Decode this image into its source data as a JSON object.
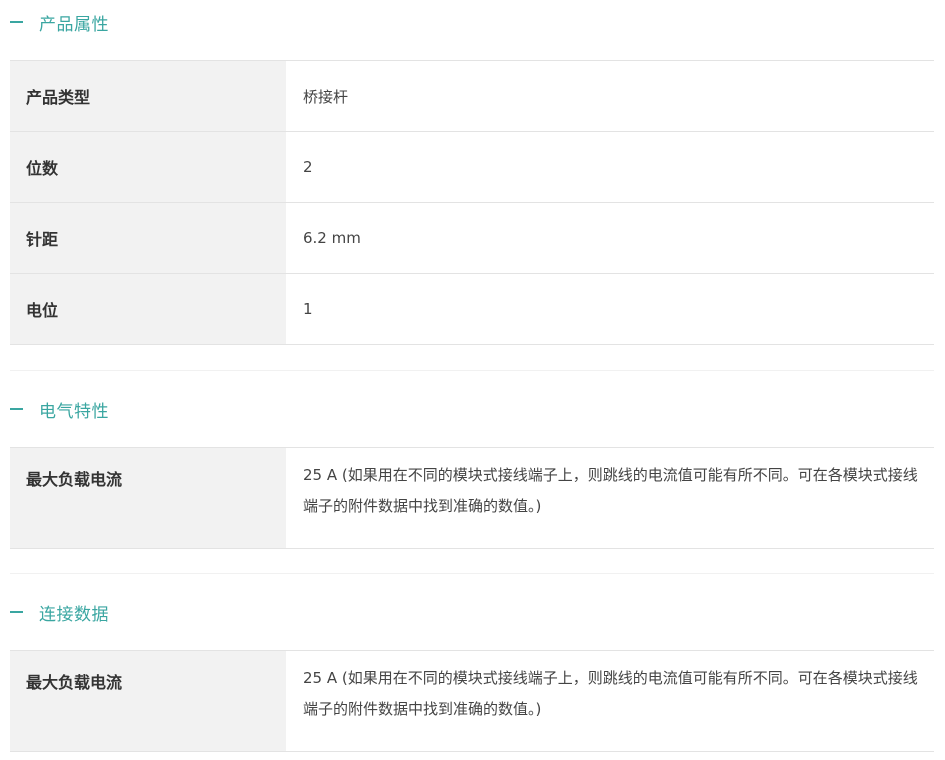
{
  "sections": [
    {
      "title": "产品属性",
      "rows": [
        {
          "label": "产品类型",
          "value": "桥接杆"
        },
        {
          "label": "位数",
          "value": "2"
        },
        {
          "label": "针距",
          "value": "6.2 mm"
        },
        {
          "label": "电位",
          "value": "1"
        }
      ]
    },
    {
      "title": "电气特性",
      "rows": [
        {
          "label": "最大负载电流",
          "value": "25 A (如果用在不同的模块式接线端子上，则跳线的电流值可能有所不同。可在各模块式接线端子的附件数据中找到准确的数值。)"
        }
      ]
    },
    {
      "title": "连接数据",
      "rows": [
        {
          "label": "最大负载电流",
          "value": "25 A (如果用在不同的模块式接线端子上，则跳线的电流值可能有所不同。可在各模块式接线端子的附件数据中找到准确的数值。)"
        }
      ]
    }
  ],
  "colors": {
    "accent": "#3aa6a1",
    "label_bg": "#f2f2f2",
    "border": "#e3e3e3"
  },
  "icons": {
    "collapse": "minus-icon"
  }
}
